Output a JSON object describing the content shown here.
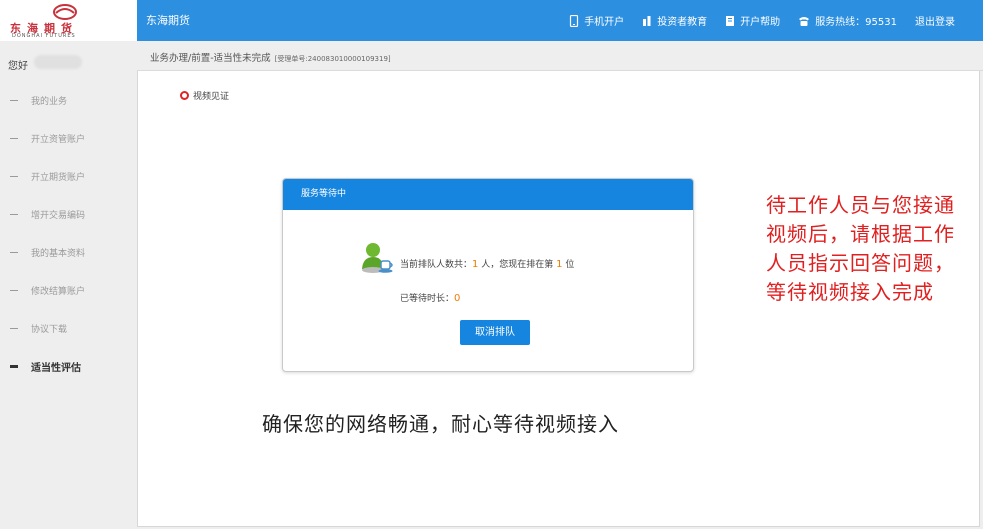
{
  "header": {
    "logo_cn": "东海期货",
    "logo_en": "DONGHAI FUTURES",
    "brand_title": "东海期货",
    "nav": [
      {
        "icon": "phone-icon",
        "label": "手机开户"
      },
      {
        "icon": "investor-icon",
        "label": "投资者教育"
      },
      {
        "icon": "book-icon",
        "label": "开户帮助"
      },
      {
        "icon": "telephone-icon",
        "label": "服务热线：95531"
      },
      {
        "icon": "",
        "label": "退出登录"
      }
    ]
  },
  "sidebar": {
    "greeting": "您好",
    "items": [
      {
        "label": "我的业务",
        "active": false
      },
      {
        "label": "开立资管账户",
        "active": false
      },
      {
        "label": "开立期货账户",
        "active": false
      },
      {
        "label": "增开交易编码",
        "active": false
      },
      {
        "label": "我的基本资料",
        "active": false
      },
      {
        "label": "修改结算账户",
        "active": false
      },
      {
        "label": "协议下载",
        "active": false
      },
      {
        "label": "适当性评估",
        "active": true
      }
    ]
  },
  "breadcrumb": {
    "path": "业务办理/前置-适当性未完成",
    "ticket": "[受理单号:240083010000109319]"
  },
  "step": {
    "label": "视频见证"
  },
  "dialog": {
    "title": "服务等待中",
    "queue_prefix": "当前排队人数共：",
    "queue_count": "1",
    "queue_mid": " 人，您现在排在第 ",
    "queue_pos": "1",
    "queue_suffix": " 位",
    "wait_prefix": "已等待时长：",
    "wait_value": "0",
    "cancel_label": "取消排队"
  },
  "notes": {
    "bottom": "确保您的网络畅通，耐心等待视频接入",
    "right": "待工作人员与您接通视频后，请根据工作人员指示回答问题，等待视频接入完成"
  },
  "colors": {
    "header_blue": "#2c8fe0",
    "dialog_blue": "#1585df",
    "accent_orange": "#f07c00",
    "note_red": "#e02020"
  }
}
